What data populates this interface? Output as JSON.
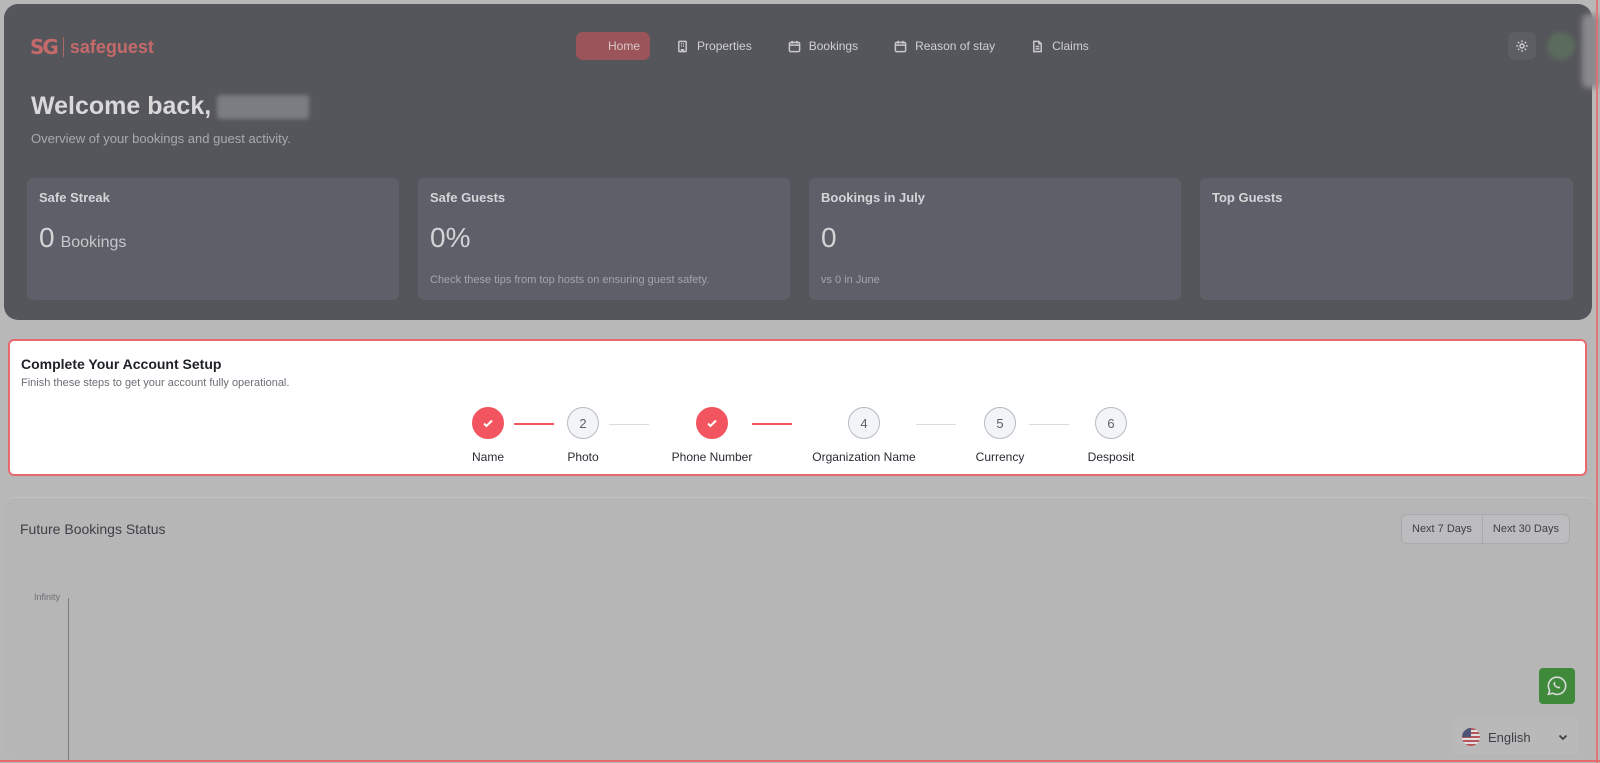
{
  "brand": {
    "mark": "SG",
    "name": "safeguest"
  },
  "nav": {
    "items": [
      {
        "label": "Home",
        "icon": "home-icon",
        "active": true
      },
      {
        "label": "Properties",
        "icon": "building-icon",
        "active": false
      },
      {
        "label": "Bookings",
        "icon": "calendar-icon",
        "active": false
      },
      {
        "label": "Reason of stay",
        "icon": "calendar-icon",
        "active": false
      },
      {
        "label": "Claims",
        "icon": "document-icon",
        "active": false
      }
    ]
  },
  "hero": {
    "welcome": "Welcome back,",
    "subtitle": "Overview of your bookings and guest activity."
  },
  "stats": [
    {
      "title": "Safe Streak",
      "value": "0",
      "unit": "Bookings",
      "note": ""
    },
    {
      "title": "Safe Guests",
      "value": "0%",
      "unit": "",
      "note": "Check these tips from top hosts on ensuring guest safety."
    },
    {
      "title": "Bookings in July",
      "value": "0",
      "unit": "",
      "note": "vs 0 in June"
    },
    {
      "title": "Top Guests",
      "value": "",
      "unit": "",
      "note": ""
    }
  ],
  "setup": {
    "title": "Complete Your Account Setup",
    "subtitle": "Finish these steps to get your account fully operational.",
    "steps": [
      {
        "number": "1",
        "label": "Name",
        "done": true
      },
      {
        "number": "2",
        "label": "Photo",
        "done": false
      },
      {
        "number": "3",
        "label": "Phone Number",
        "done": true
      },
      {
        "number": "4",
        "label": "Organization Name",
        "done": false
      },
      {
        "number": "5",
        "label": "Currency",
        "done": false
      },
      {
        "number": "6",
        "label": "Desposit",
        "done": false
      }
    ]
  },
  "future": {
    "title": "Future Bookings Status",
    "ranges": [
      "Next 7 Days",
      "Next 30 Days"
    ],
    "axis_label": "Infinity"
  },
  "language": {
    "selected": "English"
  },
  "colors": {
    "accent": "#f2555f",
    "overlay": "#55565b"
  }
}
